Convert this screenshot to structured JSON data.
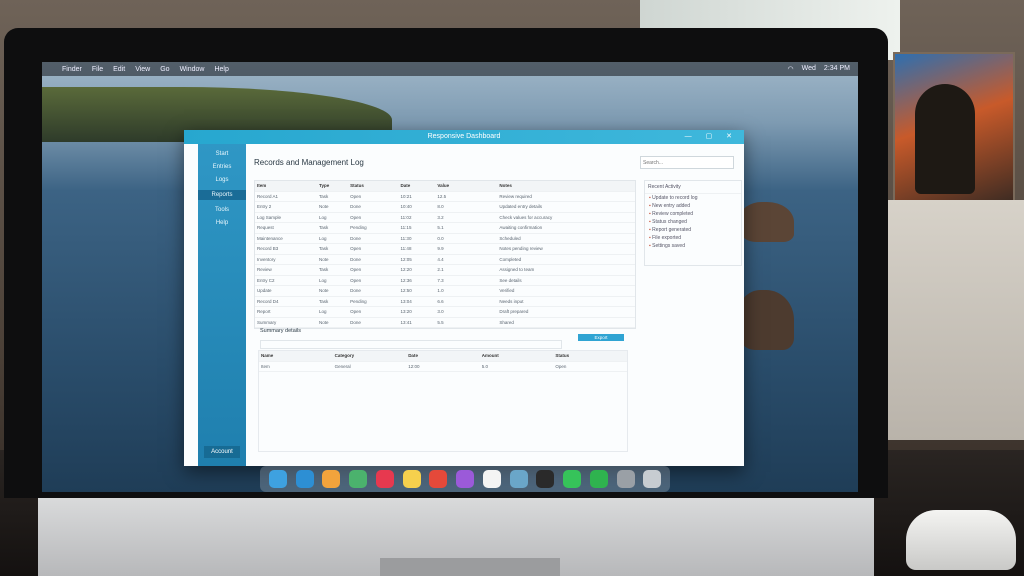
{
  "menubar": {
    "items": [
      "Finder",
      "File",
      "Edit",
      "View",
      "Go",
      "Window",
      "Help"
    ],
    "status": [
      "Wed",
      "2:34 PM"
    ]
  },
  "window": {
    "title": "Responsive Dashboard",
    "controls": "— ▢ ✕",
    "breadcrumb": "Records and Management Log",
    "search_placeholder": "Search...",
    "sidebar": {
      "items": [
        {
          "label": "Start",
          "active": false
        },
        {
          "label": "Entries",
          "active": false
        },
        {
          "label": "Logs",
          "active": false
        },
        {
          "label": "Reports",
          "active": true
        },
        {
          "label": "Tools",
          "active": false
        },
        {
          "label": "Help",
          "active": false
        }
      ],
      "footer": "Account"
    },
    "table": {
      "columns": [
        "Item",
        "Type",
        "Status",
        "Date",
        "Value",
        "Notes"
      ],
      "rows": [
        [
          "Record A1",
          "Task",
          "Open",
          "10:21",
          "12.5",
          "Review required"
        ],
        [
          "Entry 2",
          "Note",
          "Done",
          "10:40",
          "8.0",
          "Updated entry details"
        ],
        [
          "Log Sample",
          "Log",
          "Open",
          "11:02",
          "3.2",
          "Check values for accuracy"
        ],
        [
          "Request",
          "Task",
          "Pending",
          "11:15",
          "5.1",
          "Awaiting confirmation"
        ],
        [
          "Maintenance",
          "Log",
          "Done",
          "11:30",
          "0.0",
          "Scheduled"
        ],
        [
          "Record B3",
          "Task",
          "Open",
          "11:48",
          "9.9",
          "Notes pending review"
        ],
        [
          "Inventory",
          "Note",
          "Done",
          "12:05",
          "4.4",
          "Completed"
        ],
        [
          "Review",
          "Task",
          "Open",
          "12:20",
          "2.1",
          "Assigned to team"
        ],
        [
          "Entry C2",
          "Log",
          "Open",
          "12:36",
          "7.3",
          "See details"
        ],
        [
          "Update",
          "Note",
          "Done",
          "12:50",
          "1.0",
          "Verified"
        ],
        [
          "Record D4",
          "Task",
          "Pending",
          "13:04",
          "6.6",
          "Needs input"
        ],
        [
          "Report",
          "Log",
          "Open",
          "13:20",
          "3.0",
          "Draft prepared"
        ],
        [
          "Summary",
          "Note",
          "Done",
          "13:41",
          "5.5",
          "Shared"
        ]
      ]
    },
    "section": {
      "title": "Summary details",
      "button": "Export"
    },
    "table2": {
      "columns": [
        "Name",
        "Category",
        "Date",
        "Amount",
        "Status"
      ],
      "rows": [
        [
          "Item",
          "General",
          "12:00",
          "5.0",
          "Open"
        ]
      ]
    },
    "panel": {
      "title": "Recent Activity",
      "rows": [
        "Update to record log",
        "New entry added",
        "Review completed",
        "Status changed",
        "Report generated",
        "File exported",
        "Settings saved"
      ]
    }
  },
  "dock_icons": [
    {
      "name": "finder-icon",
      "color": "#3ea1e0"
    },
    {
      "name": "safari-icon",
      "color": "#2d8fd4"
    },
    {
      "name": "photos-icon",
      "color": "#f2a33c"
    },
    {
      "name": "maps-icon",
      "color": "#4bb26d"
    },
    {
      "name": "music-icon",
      "color": "#e7394f"
    },
    {
      "name": "notes-icon",
      "color": "#f6d04d"
    },
    {
      "name": "chrome-icon",
      "color": "#e5493a"
    },
    {
      "name": "podcasts-icon",
      "color": "#9b5ad9"
    },
    {
      "name": "calendar-icon",
      "color": "#f4f4f4"
    },
    {
      "name": "network-icon",
      "color": "#6aa6c9"
    },
    {
      "name": "terminal-icon",
      "color": "#2a2a2a"
    },
    {
      "name": "messages-icon",
      "color": "#36c35a"
    },
    {
      "name": "facetime-icon",
      "color": "#2fb34f"
    },
    {
      "name": "settings-icon",
      "color": "#9aa0a6"
    },
    {
      "name": "trash-icon",
      "color": "#c7ccd1"
    }
  ]
}
